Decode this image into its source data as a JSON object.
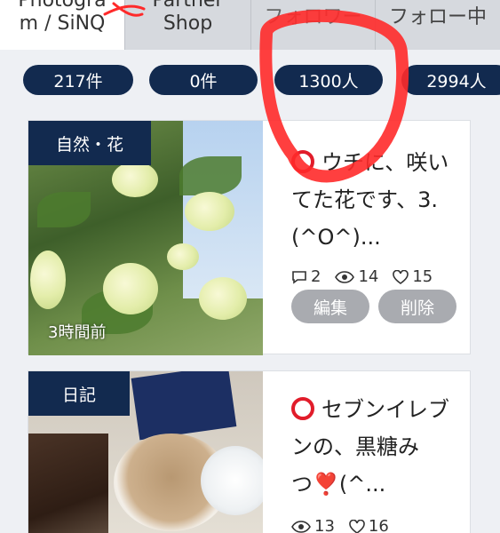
{
  "tabs": [
    {
      "line1": "Photogra",
      "line2": "m / SiNQ"
    },
    {
      "line1": "Partner",
      "line2": "Shop"
    },
    {
      "line1": "フォロワー",
      "line2": ""
    },
    {
      "line1": "フォロー中",
      "line2": ""
    }
  ],
  "counts": [
    "217件",
    "0件",
    "1300人",
    "2994人"
  ],
  "posts": [
    {
      "category": "自然・花",
      "time": "3時間前",
      "title": "ウチに、咲いてた花です、3.(^O^)...",
      "comments": "2",
      "views": "14",
      "likes": "15",
      "edit_label": "編集",
      "delete_label": "削除"
    },
    {
      "category": "日記",
      "title": "セブンイレブンの、黒糖みつ❣️(^...",
      "views": "13",
      "likes": "16"
    }
  ],
  "colors": {
    "navy": "#122a4f",
    "annotation_red": "#ff2a2a",
    "button_gray": "#a9abb0"
  }
}
